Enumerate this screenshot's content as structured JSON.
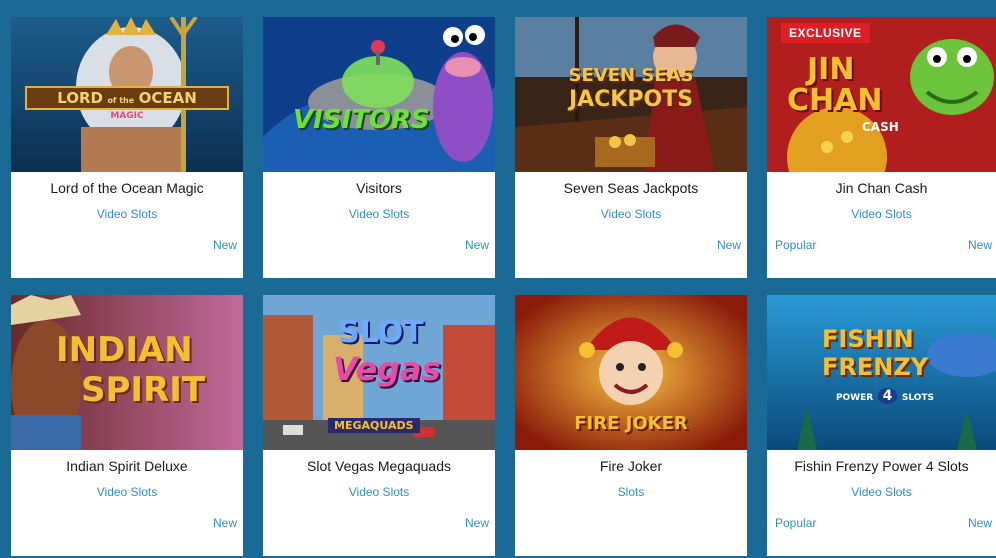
{
  "games": [
    {
      "title": "Lord of the Ocean Magic",
      "category": "Video Slots",
      "new_label": "New",
      "logo_text": [
        "LORD",
        "of the",
        "OCEAN",
        "MAGIC"
      ]
    },
    {
      "title": "Visitors",
      "category": "Video Slots",
      "new_label": "New",
      "logo_text": [
        "VISITORS"
      ]
    },
    {
      "title": "Seven Seas Jackpots",
      "category": "Video Slots",
      "new_label": "New",
      "logo_text": [
        "SEVEN SEAS",
        "JACKPOTS"
      ]
    },
    {
      "title": "Jin Chan Cash",
      "category": "Video Slots",
      "new_label": "New",
      "popular_label": "Popular",
      "exclusive_label": "EXCLUSIVE",
      "logo_text": [
        "JIN",
        "CHAN",
        "CASH"
      ]
    },
    {
      "title": "Indian Spirit Deluxe",
      "category": "Video Slots",
      "new_label": "New",
      "logo_text": [
        "INDIAN",
        "SPIRIT"
      ]
    },
    {
      "title": "Slot Vegas Megaquads",
      "category": "Video Slots",
      "new_label": "New",
      "logo_text": [
        "SLOT",
        "Vegas",
        "MEGAQUADS"
      ]
    },
    {
      "title": "Fire Joker",
      "category": "Slots",
      "logo_text": [
        "FIRE JOKER"
      ]
    },
    {
      "title": "Fishin Frenzy Power 4 Slots",
      "category": "Video Slots",
      "new_label": "New",
      "popular_label": "Popular",
      "logo_text": [
        "FISHIN",
        "FRENZY",
        "POWER",
        "4",
        "SLOTS"
      ]
    }
  ],
  "colors": {
    "page_background": "#1b6a96",
    "card_background": "#ffffff",
    "link_blue": "#2f8fcc",
    "exclusive_red": "#e01e28"
  }
}
